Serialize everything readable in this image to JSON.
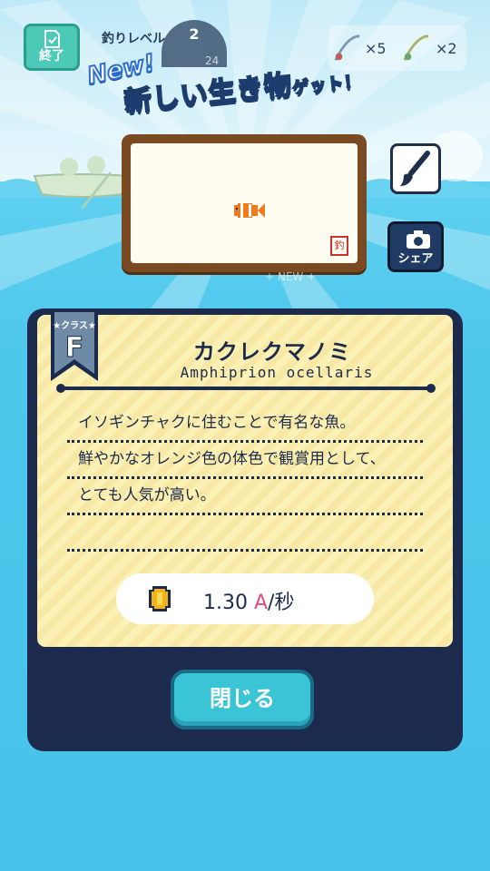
{
  "hud": {
    "end_label": "終了",
    "level_label": "釣りレベル",
    "level_value": "2",
    "level_progress_text": "24",
    "item1_count": "×5",
    "item2_count": "×2"
  },
  "banner": {
    "new_tag": "New!",
    "title_main": "新しい生き物",
    "title_suffix": "ゲット！"
  },
  "frame": {
    "stamp": "釣"
  },
  "faint_text": "+ NEW +",
  "share_label": "シェア",
  "card": {
    "class_label": "★クラス★",
    "class_letter": "F",
    "name_jp": "カクレクマノミ",
    "name_sci": "Amphiprion ocellaris",
    "description": [
      "イソギンチャクに住むことで有名な魚。",
      "鮮やかなオレンジ色の体色で観賞用として、",
      "とても人気が高い。",
      ""
    ],
    "rate_value": "1.30",
    "rate_unit": "A",
    "rate_per": "/秒"
  },
  "close_label": "閉じる",
  "colors": {
    "navy": "#1c2b4d",
    "card_yellow": "#fbf1b4",
    "close_teal": "#3bc4d6",
    "accent_pink": "#e64a7a"
  }
}
